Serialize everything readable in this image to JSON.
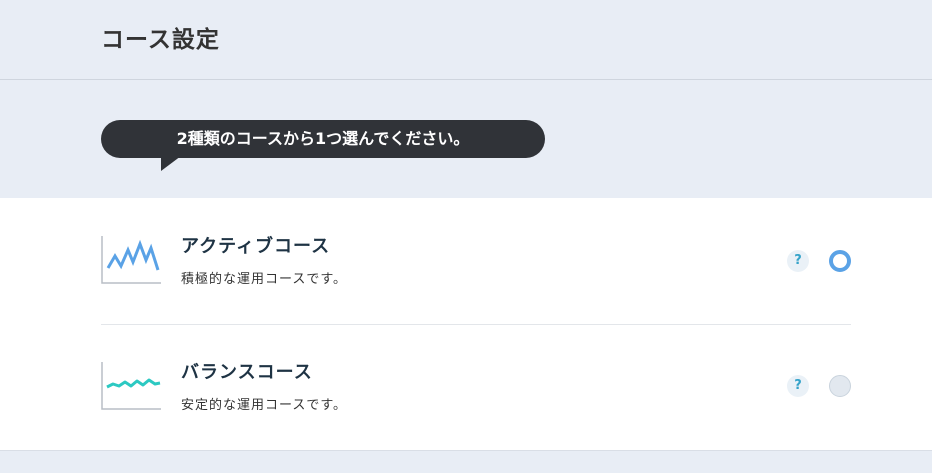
{
  "header": {
    "title": "コース設定"
  },
  "prompt": {
    "text": "2種類のコースから1つ選んでください。"
  },
  "options": [
    {
      "title": "アクティブコース",
      "description": "積極的な運用コースです。",
      "help_label": "?",
      "selected": true,
      "icon": "zigzag-chart-icon",
      "line_color": "#5aa2e6"
    },
    {
      "title": "バランスコース",
      "description": "安定的な運用コースです。",
      "help_label": "?",
      "selected": false,
      "icon": "wave-chart-icon",
      "line_color": "#2cc9c2"
    }
  ],
  "colors": {
    "background": "#e8edf5",
    "bubble": "#303338",
    "radio_selected": "#5aa2e6",
    "help_text": "#36a3c9"
  }
}
